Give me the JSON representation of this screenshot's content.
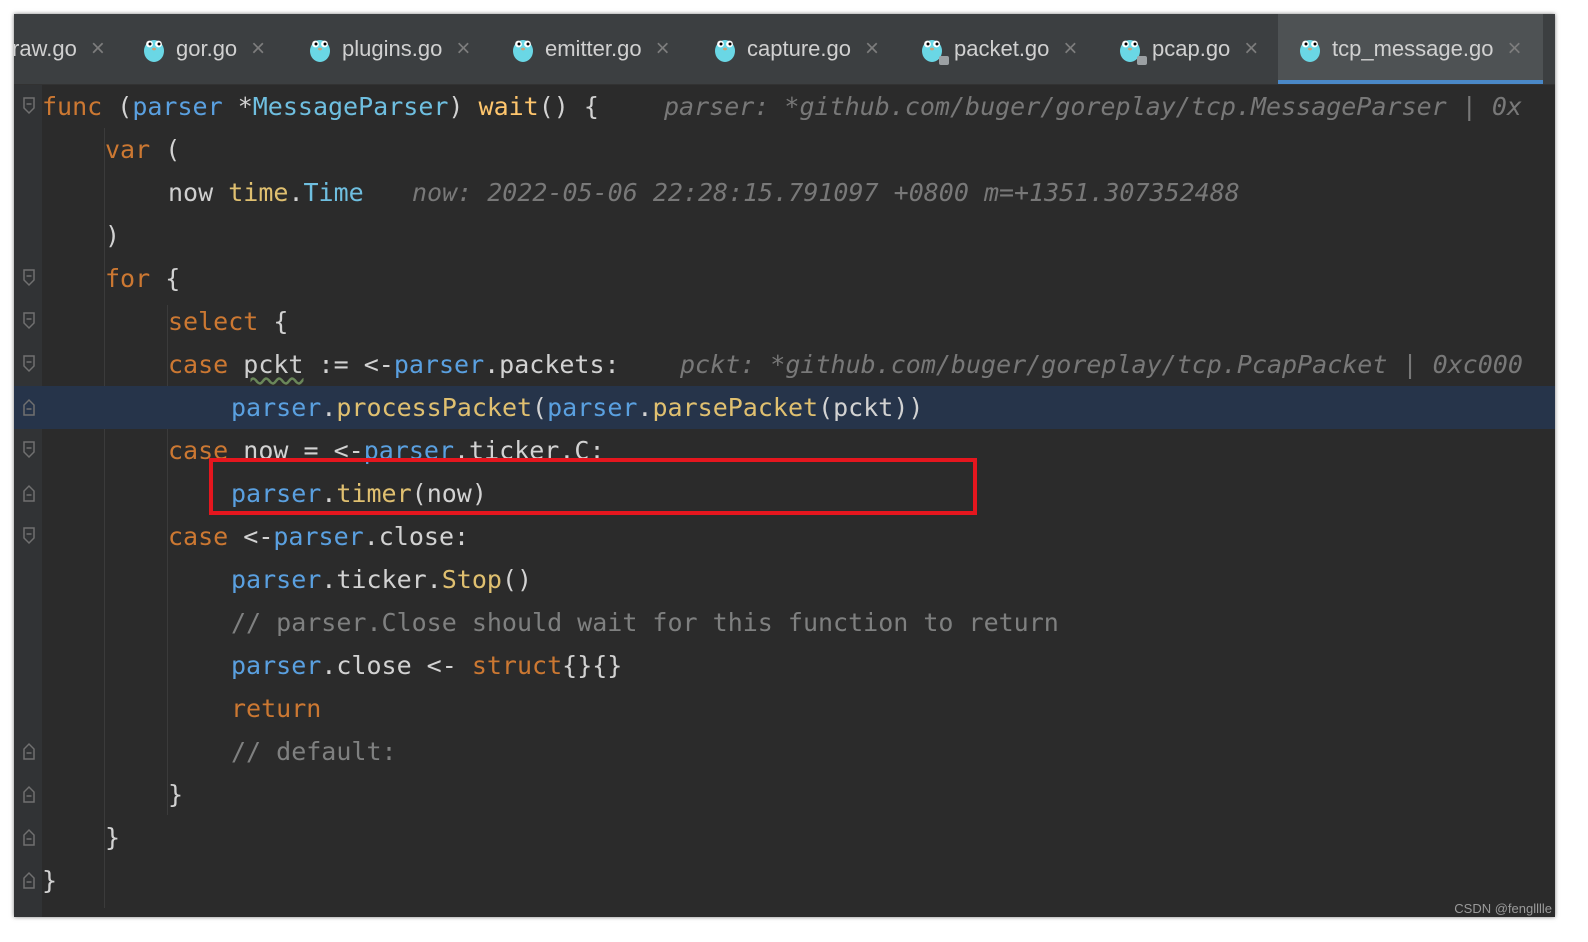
{
  "tabs": [
    {
      "label": "raw.go",
      "active": false,
      "icon": "go-gopher-icon"
    },
    {
      "label": "gor.go",
      "active": false,
      "icon": "go-gopher-icon"
    },
    {
      "label": "plugins.go",
      "active": false,
      "icon": "go-gopher-icon"
    },
    {
      "label": "emitter.go",
      "active": false,
      "icon": "go-gopher-icon"
    },
    {
      "label": "capture.go",
      "active": false,
      "icon": "go-gopher-icon"
    },
    {
      "label": "packet.go",
      "active": false,
      "icon": "go-gopher-locked-icon"
    },
    {
      "label": "pcap.go",
      "active": false,
      "icon": "go-gopher-locked-icon"
    },
    {
      "label": "tcp_message.go",
      "active": true,
      "icon": "go-gopher-icon"
    }
  ],
  "code": {
    "l1": {
      "kw_func": "func",
      "p1": " (",
      "recv": "parser",
      "p2": " *",
      "type": "MessageParser",
      "p3": ") ",
      "fn": "wait",
      "p4": "() {",
      "hint": "parser: *github.com/buger/goreplay/tcp.MessageParser | 0x"
    },
    "l2": {
      "kw": "var",
      "p": " ("
    },
    "l3": {
      "name": "now ",
      "pkg": "time",
      "dot": ".",
      "type": "Time",
      "hint": "now: 2022-05-06 22:28:15.791097 +0800 m=+1351.307352488"
    },
    "l4": {
      "p": ")"
    },
    "l5": {
      "kw": "for",
      "p": " {"
    },
    "l6": {
      "kw": "select",
      "p": " {"
    },
    "l7": {
      "kw": "case",
      "var": "pckt",
      "op": " := <-",
      "recv": "parser",
      "rest": ".packets:",
      "hint": "pckt: *github.com/buger/goreplay/tcp.PcapPacket | 0xc000"
    },
    "l8": {
      "recv1": "parser",
      "dot1": ".",
      "fn1": "processPacket",
      "p1": "(",
      "recv2": "parser",
      "dot2": ".",
      "fn2": "parsePacket",
      "p2": "(pckt))"
    },
    "l9": {
      "kw": "case",
      "rest": " now = <-",
      "recv": "parser",
      "rest2": ".ticker.C:"
    },
    "l10": {
      "recv": "parser",
      "dot": ".",
      "fn": "timer",
      "p": "(now)"
    },
    "l11": {
      "kw": "case",
      "p": " <-",
      "recv": "parser",
      "rest": ".close:"
    },
    "l12": {
      "recv": "parser",
      "mid": ".ticker.",
      "fn": "Stop",
      "p": "()"
    },
    "l13": {
      "comment": "// parser.Close should wait for this function to return"
    },
    "l14": {
      "recv": "parser",
      "mid": ".close <- ",
      "kw": "struct",
      "p": "{}{}"
    },
    "l15": {
      "kw": "return"
    },
    "l16": {
      "comment": "// default:"
    },
    "l17": {
      "p": "}"
    },
    "l18": {
      "p": "}"
    },
    "l19": {
      "p": "}"
    }
  },
  "watermark": "CSDN @fenglllle",
  "colors": {
    "keyword": "#cc7832",
    "function": "#ffc66d",
    "receiver": "#5aa0e0",
    "comment": "#7f8080",
    "highlight_box": "#e5161e",
    "active_tab_underline": "#4a88c7"
  }
}
